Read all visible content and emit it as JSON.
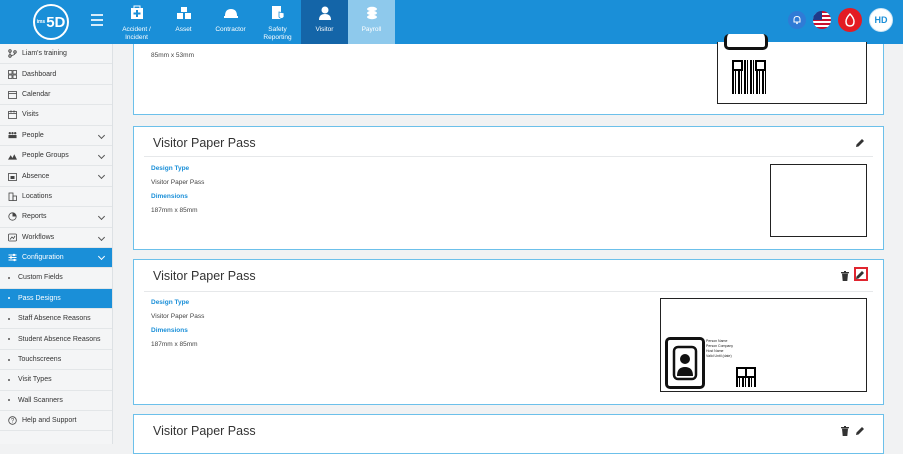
{
  "logo": {
    "text": "5D",
    "prefix": "ims"
  },
  "modules": [
    {
      "label": "Accident / Incident",
      "icon": "first-aid-icon"
    },
    {
      "label": "Asset",
      "icon": "asset-icon"
    },
    {
      "label": "Contractor",
      "icon": "hard-hat-icon"
    },
    {
      "label": "Safety Reporting",
      "icon": "safety-report-icon"
    },
    {
      "label": "Visitor",
      "icon": "visitor-icon"
    },
    {
      "label": "Payroll",
      "icon": "payroll-icon"
    }
  ],
  "user": {
    "initials": "HD"
  },
  "sidebar": {
    "items": [
      {
        "label": "Liam's training",
        "icon": "branch-icon"
      },
      {
        "label": "Dashboard",
        "icon": "dashboard-icon"
      },
      {
        "label": "Calendar",
        "icon": "calendar-icon"
      },
      {
        "label": "Visits",
        "icon": "visits-icon"
      },
      {
        "label": "People",
        "icon": "people-icon"
      },
      {
        "label": "People Groups",
        "icon": "people-groups-icon"
      },
      {
        "label": "Absence",
        "icon": "absence-icon"
      },
      {
        "label": "Locations",
        "icon": "locations-icon"
      },
      {
        "label": "Reports",
        "icon": "reports-icon"
      },
      {
        "label": "Workflows",
        "icon": "workflows-icon"
      },
      {
        "label": "Configuration",
        "icon": "configuration-icon"
      }
    ],
    "sub_items": [
      {
        "label": "Custom Fields"
      },
      {
        "label": "Pass Designs"
      },
      {
        "label": "Staff Absence Reasons"
      },
      {
        "label": "Student Absence Reasons"
      },
      {
        "label": "Touchscreens"
      },
      {
        "label": "Visit Types"
      },
      {
        "label": "Wall Scanners"
      }
    ],
    "help": {
      "label": "Help and Support"
    }
  },
  "top_card": {
    "dimensions_value": "85mm x 53mm"
  },
  "cards": [
    {
      "title": "Visitor Paper Pass",
      "design_type_label": "Design Type",
      "design_type_value": "Visitor Paper Pass",
      "dimensions_label": "Dimensions",
      "dimensions_value": "187mm x 85mm"
    },
    {
      "title": "Visitor Paper Pass",
      "design_type_label": "Design Type",
      "design_type_value": "Visitor Paper Pass",
      "dimensions_label": "Dimensions",
      "dimensions_value": "187mm x 85mm",
      "preview_text": {
        "person_name": "Person Name",
        "person_company": "Person Company",
        "host_name": "Host Name",
        "valid_until": "Valid Until (date)"
      }
    },
    {
      "title": "Visitor Paper Pass"
    }
  ],
  "colors": {
    "primary": "#1a8fd8",
    "dark_active": "#1465a8",
    "highlight": "#e0252f"
  }
}
